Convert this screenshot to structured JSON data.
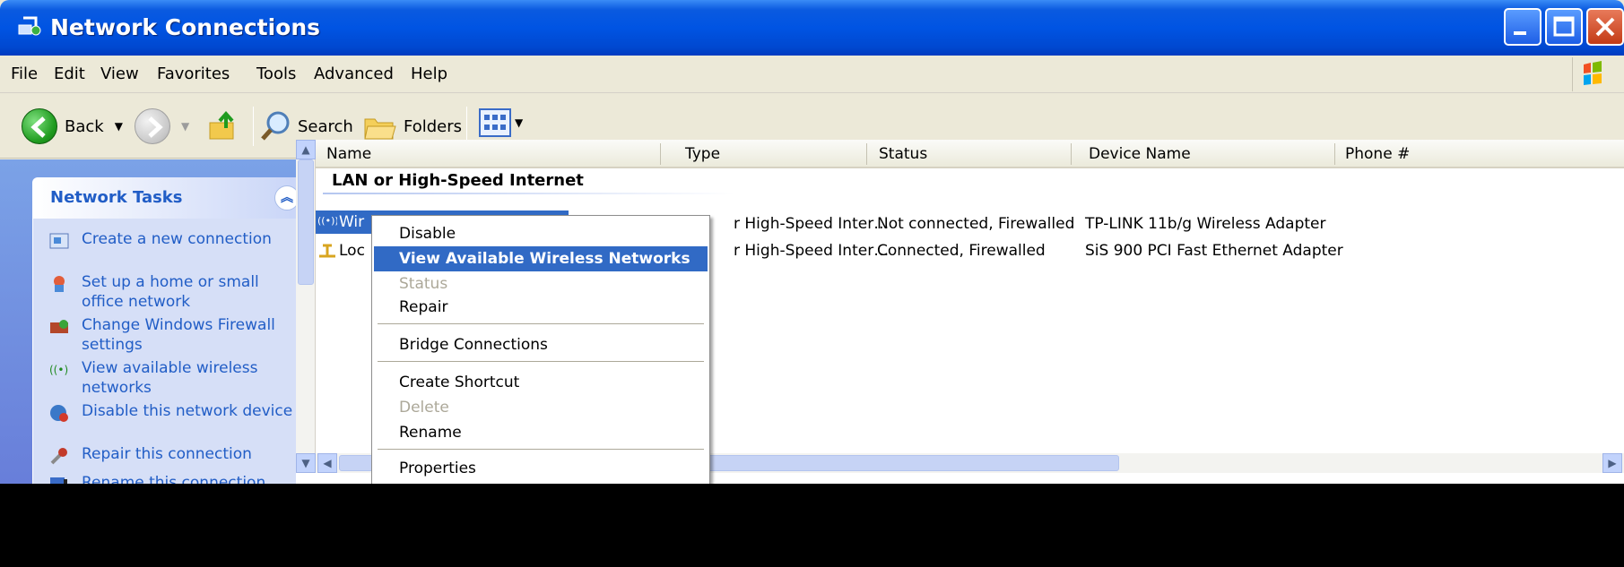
{
  "window": {
    "title": "Network Connections"
  },
  "menubar": {
    "items": [
      "File",
      "Edit",
      "View",
      "Favorites",
      "Tools",
      "Advanced",
      "Help"
    ]
  },
  "toolbar": {
    "back_label": "Back",
    "search_label": "Search",
    "folders_label": "Folders"
  },
  "taskpane": {
    "title": "Network Tasks",
    "tasks": [
      {
        "label": "Create a new connection",
        "icon": "new-connection-icon"
      },
      {
        "label": "Set up a home or small office network",
        "icon": "home-network-icon"
      },
      {
        "label": "Change Windows Firewall settings",
        "icon": "firewall-icon"
      },
      {
        "label": "View available wireless networks",
        "icon": "wireless-icon"
      },
      {
        "label": "Disable this network device",
        "icon": "disable-network-icon"
      },
      {
        "label": "Repair this connection",
        "icon": "repair-icon"
      },
      {
        "label": "Rename this connection",
        "icon": "rename-icon"
      }
    ]
  },
  "list": {
    "columns": [
      "Name",
      "Type",
      "Status",
      "Device Name",
      "Phone #"
    ],
    "group_title": "LAN or High-Speed Internet",
    "rows": [
      {
        "name_visible": "Wir",
        "type": "r High-Speed Inter…",
        "status": "Not connected, Firewalled",
        "device": "TP-LINK 11b/g Wireless Adapter"
      },
      {
        "name_visible": "Loc",
        "type": "r High-Speed Inter…",
        "status": "Connected, Firewalled",
        "device": "SiS 900 PCI Fast Ethernet Adapter"
      }
    ]
  },
  "context_menu": {
    "items": [
      {
        "label": "Disable",
        "state": "normal"
      },
      {
        "label": "View Available Wireless Networks",
        "state": "active"
      },
      {
        "label": "Status",
        "state": "disabled"
      },
      {
        "label": "Repair",
        "state": "normal"
      },
      {
        "label": "Bridge Connections",
        "state": "normal"
      },
      {
        "label": "Create Shortcut",
        "state": "normal"
      },
      {
        "label": "Delete",
        "state": "disabled"
      },
      {
        "label": "Rename",
        "state": "normal"
      },
      {
        "label": "Properties",
        "state": "normal"
      }
    ]
  },
  "colors": {
    "title_bar": "#0054e3",
    "selection": "#316ac5",
    "task_link": "#215dc6",
    "task_pane_bg": "#6375d6"
  }
}
